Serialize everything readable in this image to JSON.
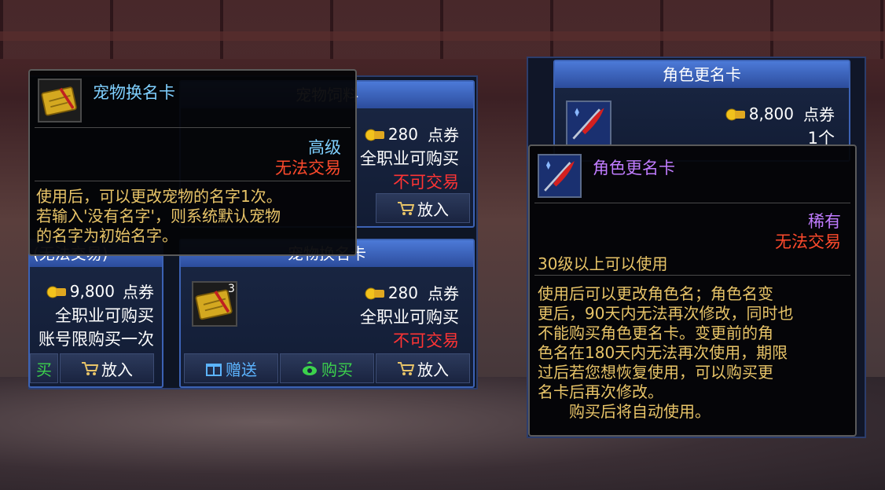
{
  "left_shop": {
    "card_top_title": "宠物饲料",
    "card_top": {
      "price": "280",
      "currency": "点券",
      "job": "全职业可购买",
      "trade": "不可交易",
      "btn_put": "放入"
    },
    "card_left": {
      "title": "(无法交易)",
      "price": "9,800",
      "currency": "点券",
      "job": "全职业可购买",
      "limit": "账号限购买一次",
      "btn_partial": "买",
      "btn_put": "放入"
    },
    "card_main": {
      "title": "宠物换名卡",
      "count": "3",
      "price": "280",
      "currency": "点券",
      "job": "全职业可购买",
      "trade": "不可交易",
      "btn_gift": "赠送",
      "btn_buy": "购买",
      "btn_put": "放入"
    }
  },
  "left_tooltip": {
    "title": "宠物换名卡",
    "grade": "高级",
    "trade": "无法交易",
    "desc_lines": [
      "使用后，可以更改宠物的名字1次。",
      "若输入'没有名字'，则系统默认宠物",
      "的名字为初始名字。"
    ],
    "colors": {
      "title": "#7fd0ff",
      "grade": "#7fd0ff",
      "trade": "#ff4a2c",
      "desc": "#e8c468"
    }
  },
  "right_shop": {
    "card_title": "角色更名卡",
    "price": "8,800",
    "currency": "点券",
    "quantity": "1个"
  },
  "right_tooltip": {
    "title": "角色更名卡",
    "grade": "稀有",
    "trade": "无法交易",
    "level_req": "30级以上可以使用",
    "desc_lines": [
      "使用后可以更改角色名；角色名变",
      "更后，90天内无法再次修改，同时也",
      "不能购买角色更名卡。变更前的角",
      "色名在180天内无法再次使用，期限",
      "过后若您想恢复使用，可以购买更",
      "名卡后再次修改。"
    ],
    "auto_use": "购买后将自动使用。",
    "colors": {
      "title": "#c07cff",
      "grade": "#c07cff",
      "trade": "#ff4a2c",
      "desc": "#e8c468"
    }
  }
}
